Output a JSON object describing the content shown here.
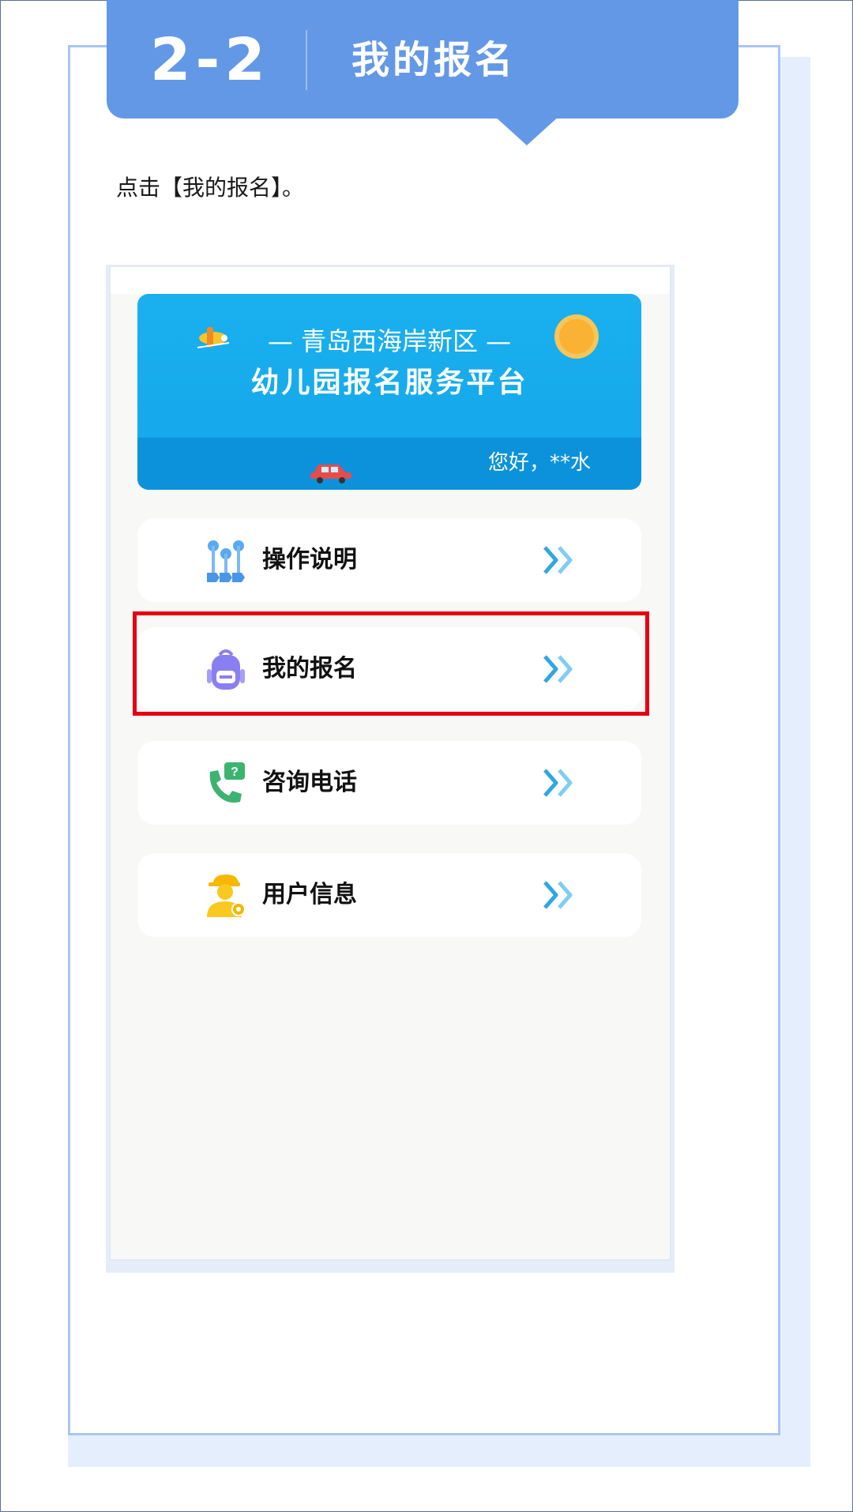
{
  "header": {
    "step": "2-2",
    "title": "我的报名"
  },
  "instruction": "点击【我的报名】。",
  "banner": {
    "line1": "— 青岛西海岸新区 —",
    "line2": "幼儿园报名服务平台",
    "greeting": "您好，**水"
  },
  "menu": [
    {
      "label": "操作说明",
      "icon": "steps-icon"
    },
    {
      "label": "我的报名",
      "icon": "backpack-icon"
    },
    {
      "label": "咨询电话",
      "icon": "phone-icon"
    },
    {
      "label": "用户信息",
      "icon": "user-icon"
    }
  ],
  "colors": {
    "header_blue": "#6398e6",
    "banner_blue": "#14a6ea",
    "highlight_red": "#e60012"
  }
}
